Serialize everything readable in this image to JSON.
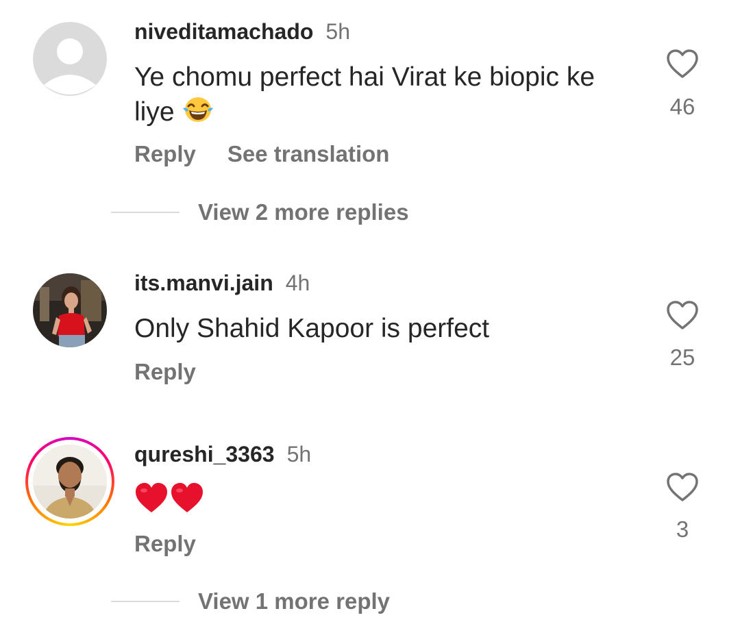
{
  "comments": [
    {
      "username": "niveditamachado",
      "time": "5h",
      "text": "Ye chomu perfect hai Virat ke biopic ke liye",
      "emoji": "face-with-tears-of-joy",
      "likes": "46",
      "reply_label": "Reply",
      "translate_label": "See translation",
      "view_replies": "View 2 more replies"
    },
    {
      "username": "its.manvi.jain",
      "time": "4h",
      "text": "Only Shahid Kapoor is perfect",
      "likes": "25",
      "reply_label": "Reply"
    },
    {
      "username": "qureshi_3363",
      "time": "5h",
      "text": "",
      "emoji": "red-heart red-heart",
      "likes": "3",
      "reply_label": "Reply",
      "view_replies": "View 1 more reply"
    }
  ],
  "colors": {
    "text_primary": "#262626",
    "text_secondary": "#737373",
    "divider": "#dbdbdb",
    "heart_emoji": "#e8112d",
    "story_ring": [
      "#d300c5",
      "#ff0069",
      "#ff7a00",
      "#ffd600"
    ]
  },
  "icons": {
    "like": "heart-outline-icon",
    "default_avatar": "default-avatar-icon"
  }
}
